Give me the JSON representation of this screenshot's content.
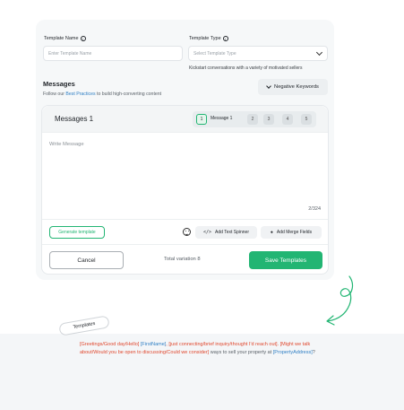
{
  "form": {
    "template_name_label": "Template Name",
    "template_name_placeholder": "Enter Template Name",
    "template_type_label": "Template Type",
    "template_type_placeholder": "Select Template Type",
    "template_type_hint": "Kickstart conversations with a variety of motivated sellers"
  },
  "messages": {
    "title": "Messages",
    "follow_prefix": "Follow our",
    "follow_link": "Best Practices",
    "follow_suffix": "to build high-converting content",
    "negative_keywords_label": "Negative Keywords"
  },
  "editor": {
    "title": "Messages 1",
    "tabs": [
      "1",
      "2",
      "3",
      "4",
      "5"
    ],
    "active_tab_label": "Message 1",
    "placeholder": "Write Message",
    "char_count": "2/324",
    "generate_label": "Generate template",
    "text_spinner_label": "Add Text Spinner",
    "merge_fields_label": "Add Merge Fields",
    "cancel_label": "Cancel",
    "total_variation": "Total variation 8",
    "save_label": "Save Templates"
  },
  "annotation": {
    "tag_label": "Templates",
    "seg1": "[Greetings/Good day/Hello]",
    "seg2": "[FirstName]",
    "seg3": ", [just connecting/brief inquiry/thought I'd reach out]. [Might we talk about/Would you be open to discussing/Could we consider]",
    "seg4": " ways to sell your property at ",
    "seg5": "[PropertyAddress]",
    "seg6": "?"
  },
  "colors": {
    "accent_green": "#22b573",
    "link_blue": "#2f7fc4",
    "spinner_red": "#e0482e"
  }
}
